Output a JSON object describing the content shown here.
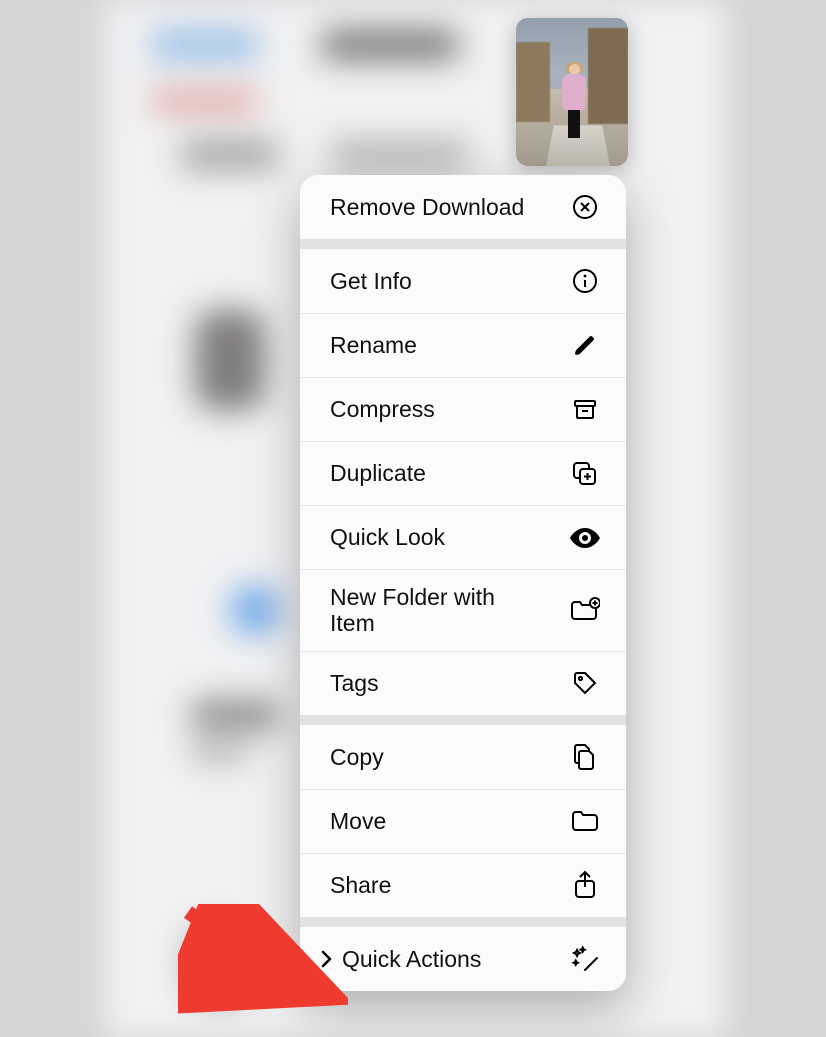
{
  "preview": {
    "name": "selected-photo-thumbnail"
  },
  "menu": {
    "groups": [
      {
        "items": [
          {
            "label": "Remove Download",
            "icon": "x-circle-icon",
            "interactable": true
          }
        ]
      },
      {
        "items": [
          {
            "label": "Get Info",
            "icon": "info-circle-icon",
            "interactable": true
          },
          {
            "label": "Rename",
            "icon": "pencil-icon",
            "interactable": true
          },
          {
            "label": "Compress",
            "icon": "archive-box-icon",
            "interactable": true
          },
          {
            "label": "Duplicate",
            "icon": "plus-square-on-square-icon",
            "interactable": true
          },
          {
            "label": "Quick Look",
            "icon": "eye-icon",
            "interactable": true
          },
          {
            "label": "New Folder with Item",
            "icon": "folder-badge-plus-icon",
            "interactable": true
          },
          {
            "label": "Tags",
            "icon": "tag-icon",
            "interactable": true
          }
        ]
      },
      {
        "items": [
          {
            "label": "Copy",
            "icon": "doc-on-doc-icon",
            "interactable": true
          },
          {
            "label": "Move",
            "icon": "folder-icon",
            "interactable": true
          },
          {
            "label": "Share",
            "icon": "square-and-arrow-up-icon",
            "interactable": true
          }
        ]
      },
      {
        "items": [
          {
            "label": "Quick Actions",
            "icon": "sparkles-wand-icon",
            "submenu": true,
            "interactable": true
          }
        ]
      }
    ]
  },
  "annotation": {
    "kind": "arrow",
    "color": "#ef3b2f",
    "target": "quick-actions-menu-item"
  }
}
